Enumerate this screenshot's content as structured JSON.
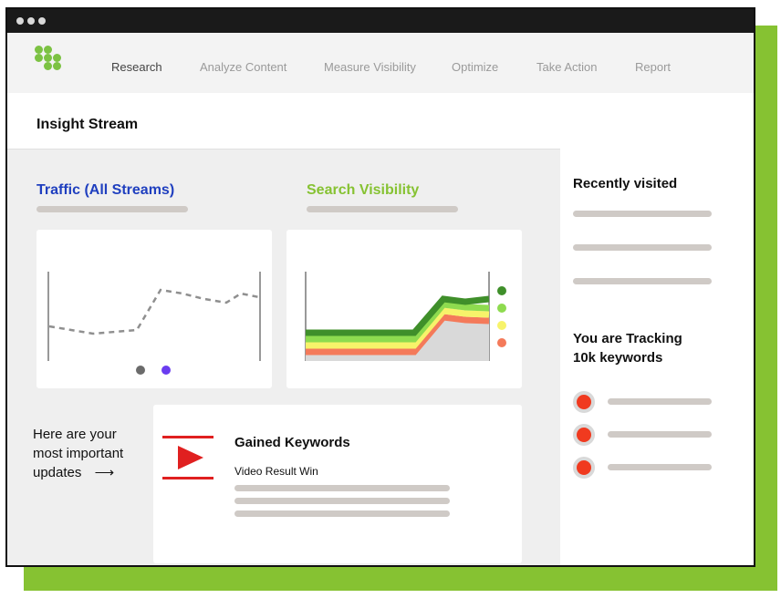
{
  "nav": {
    "items": [
      "Research",
      "Analyze Content",
      "Measure Visibility",
      "Optimize",
      "Take Action",
      "Report"
    ],
    "active": "Research"
  },
  "header": {
    "title": "Insight Stream"
  },
  "traffic": {
    "title": "Traffic (All Streams)",
    "title_color": "#1f3fbf",
    "legend_dot_colors": [
      "#6b6b6b",
      "#6a3cf0"
    ]
  },
  "visibility": {
    "title": "Search Visibility",
    "title_color": "#86c232",
    "band_colors": [
      "#3f8f2a",
      "#8edb4f",
      "#f7f36a",
      "#f47a5a"
    ]
  },
  "updates": {
    "line1": "Here are your",
    "line2": "most important",
    "line3": "updates",
    "arrow": "⟶"
  },
  "gained": {
    "title": "Gained Keywords",
    "subtitle": "Video Result Win",
    "icon": "video-play-icon"
  },
  "sidebar": {
    "recent_title": "Recently visited",
    "tracking_line1": "You are Tracking",
    "tracking_line2": "10k keywords"
  }
}
